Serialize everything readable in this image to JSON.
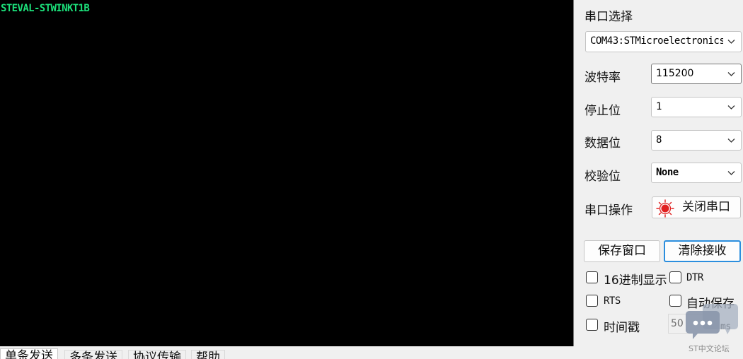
{
  "terminal": {
    "text": "STEVAL-STWINKT1B"
  },
  "settings": {
    "port": {
      "label": "串口选择",
      "value": "COM43:STMicroelectronics"
    },
    "baud": {
      "label": "波特率",
      "value": "115200"
    },
    "stopbits": {
      "label": "停止位",
      "value": "1"
    },
    "databits": {
      "label": "数据位",
      "value": "8"
    },
    "parity": {
      "label": "校验位",
      "value": "None"
    },
    "operate": {
      "label": "串口操作",
      "button": "关闭串口"
    }
  },
  "buttons": {
    "save_window": "保存窗口",
    "clear_receive": "清除接收"
  },
  "options": {
    "hex_display": "16进制显示",
    "dtr": "DTR",
    "rts": "RTS",
    "auto_save": "自动保存",
    "timestamp": "时间戳",
    "interval_value": "50",
    "interval_unit": "ms"
  },
  "tabs": [
    "单条发送",
    "多条发送",
    "协议传输",
    "帮助"
  ],
  "watermark": {
    "text": "ST中文论坛"
  },
  "colors": {
    "terminal_bg": "#000000",
    "terminal_text": "#1ce07a",
    "accent": "#2b8ede",
    "indicator_red": "#e02020"
  }
}
